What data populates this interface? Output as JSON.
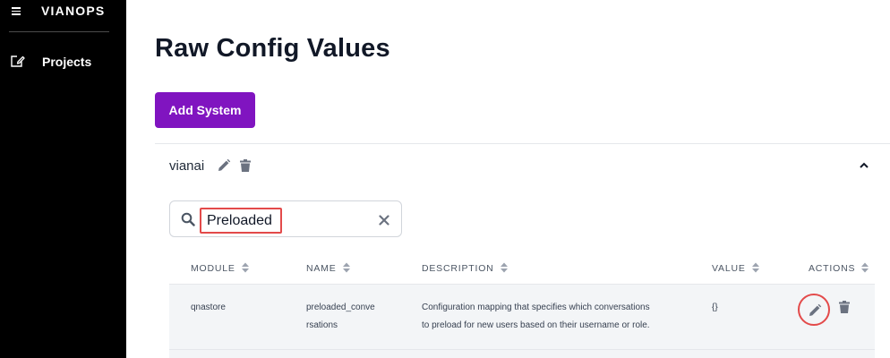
{
  "sidebar": {
    "logo": "VIANOPS",
    "menu_icon": "hamburger-icon",
    "items": [
      {
        "label": "Projects",
        "icon": "edit-square-icon"
      }
    ]
  },
  "main": {
    "title": "Raw Config Values",
    "add_button_label": "Add System",
    "system": {
      "name": "vianai",
      "edit_icon": "pencil-icon",
      "delete_icon": "trash-icon",
      "toggle_icon": "chevron-up-icon"
    },
    "search": {
      "value": "Preloaded",
      "placeholder": "",
      "clear_icon": "close-icon"
    },
    "table": {
      "columns": [
        "MODULE",
        "NAME",
        "DESCRIPTION",
        "VALUE",
        "ACTIONS"
      ],
      "rows": [
        {
          "module": "qnastore",
          "name_line1": "preloaded_conve",
          "name_line2": "rsations",
          "description_line1": "Configuration mapping that specifies which conversations",
          "description_line2": "to preload for new users based on their username or role.",
          "value": "{}"
        }
      ]
    }
  },
  "colors": {
    "sidebar_bg": "#000000",
    "accent": "#8014c0",
    "highlight": "#e34a4a",
    "icon_gray": "#6b7280"
  }
}
